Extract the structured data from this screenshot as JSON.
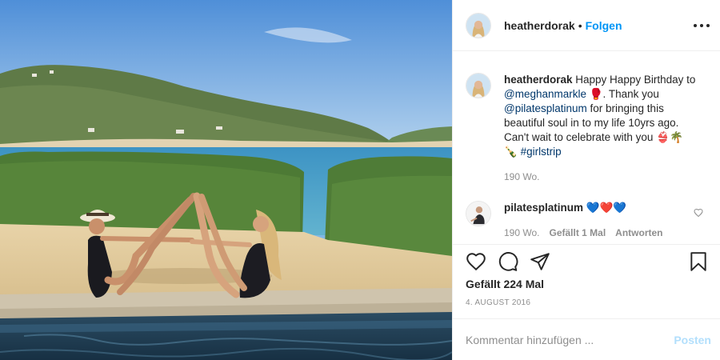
{
  "post": {
    "username": "heatherdorak",
    "separator": "•",
    "follow_label": "Folgen"
  },
  "caption": {
    "username": "heatherdorak",
    "text_1": " Happy Happy Birthday to ",
    "mention_1": "@meghanmarkle",
    "text_2": " 🥊. Thank you ",
    "mention_2": "@pilatesplatinum",
    "text_3": " for bringing this beautiful soul in to my life 10yrs ago. Can't wait to celebrate with you 👙🌴🍾 ",
    "hashtag": "#girlstrip",
    "age": "190 Wo."
  },
  "comment": {
    "username": "pilatesplatinum",
    "text": " 💙❤️💙",
    "age": "190 Wo.",
    "likes": "Gefällt 1 Mal",
    "reply_label": "Antworten"
  },
  "actions": {
    "likes_text": "Gefällt 224 Mal",
    "date": "4. AUGUST 2016",
    "icons": [
      "heart-icon",
      "comment-icon",
      "share-icon",
      "bookmark-icon"
    ]
  },
  "add_comment": {
    "placeholder": "Kommentar hinzufügen ...",
    "post_label": "Posten"
  },
  "colors": {
    "link_blue": "#0095f6",
    "mention": "#00376b",
    "muted": "#8e8e8e",
    "post_disabled": "#b2dffc"
  }
}
